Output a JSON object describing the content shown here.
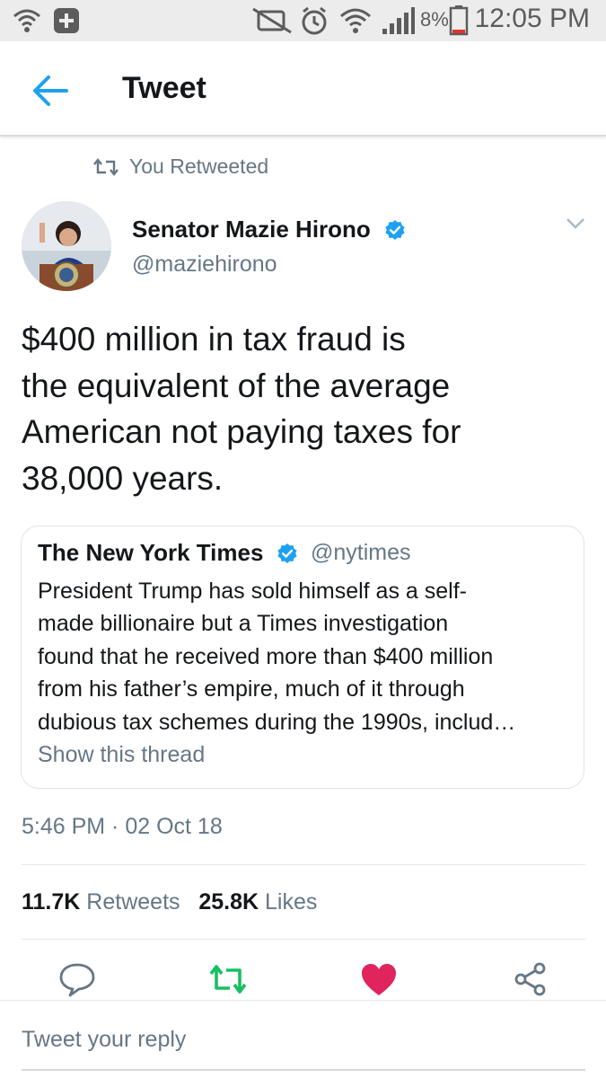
{
  "status_bar": {
    "time": "12:05 PM",
    "battery_percent": "8%",
    "battery_color": "#e0332c"
  },
  "header": {
    "title": "Tweet",
    "accent_color": "#1da1f2"
  },
  "retweet_context": {
    "label": "You Retweeted"
  },
  "tweet": {
    "author_name": "Senator Mazie Hirono",
    "author_handle": "@maziehirono",
    "text_lines": [
      "$400 million in tax fraud is",
      "the equivalent of the average",
      "American not paying taxes for",
      "38,000 years."
    ],
    "timestamp": "5:46 PM · 02 Oct 18",
    "retweets_count": "11.7K",
    "retweets_label": "Retweets",
    "likes_count": "25.8K",
    "likes_label": "Likes"
  },
  "quoted_tweet": {
    "author_name": "The New York Times",
    "author_handle": "@nytimes",
    "text_lines": [
      "President Trump has sold himself as a self-",
      "made billionaire but a Times investigation",
      "found that he received more than $400 million",
      "from his father’s empire, much of it through",
      "dubious tax schemes during the 1990s, includ…"
    ],
    "show_thread": "Show this thread"
  },
  "reply_box": {
    "placeholder": "Tweet your reply"
  },
  "actions": {
    "retweeted_color": "#17bf63",
    "liked_color": "#e0245e",
    "default_color": "#657786"
  }
}
